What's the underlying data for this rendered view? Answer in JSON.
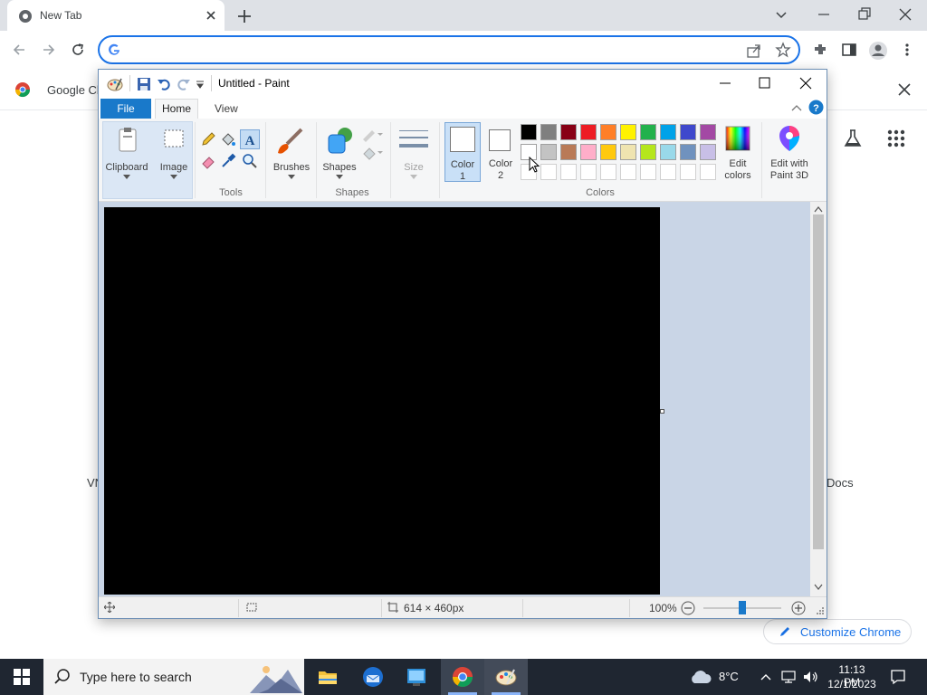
{
  "browser": {
    "tab_title": "New Tab",
    "bookmark_label": "Google Ch",
    "ntp_shortcut_left": "VN",
    "ntp_shortcut_right": "Docs",
    "customize_label": "Customize Chrome",
    "omnibox_value": ""
  },
  "paint": {
    "title": "Untitled - Paint",
    "tabs": {
      "file": "File",
      "home": "Home",
      "view": "View"
    },
    "groups": {
      "clipboard": "Clipboard",
      "image": "Image",
      "tools": "Tools",
      "brushes": "Brushes",
      "shapes_btn": "Shapes",
      "shapes": "Shapes",
      "size": "Size",
      "colors": "Colors"
    },
    "color1": [
      "Color",
      "1"
    ],
    "color2": [
      "Color",
      "2"
    ],
    "edit_colors": [
      "Edit",
      "colors"
    ],
    "edit_3d": [
      "Edit with",
      "Paint 3D"
    ],
    "palette_row1": [
      "#000000",
      "#7f7f7f",
      "#880015",
      "#ed1c24",
      "#ff7f27",
      "#fff200",
      "#22b14c",
      "#00a2e8",
      "#3f48cc",
      "#a349a4"
    ],
    "palette_row2": [
      "#ffffff",
      "#c3c3c3",
      "#b97a57",
      "#ffaec9",
      "#ffc90e",
      "#efe4b0",
      "#b5e61d",
      "#99d9ea",
      "#7092be",
      "#c8bfe7"
    ],
    "status": {
      "canvas_size": "614 × 460px",
      "zoom": "100%"
    }
  },
  "taskbar": {
    "search_placeholder": "Type here to search",
    "temperature": "8°C",
    "time": "11:13 PM",
    "date": "12/1/2023"
  }
}
